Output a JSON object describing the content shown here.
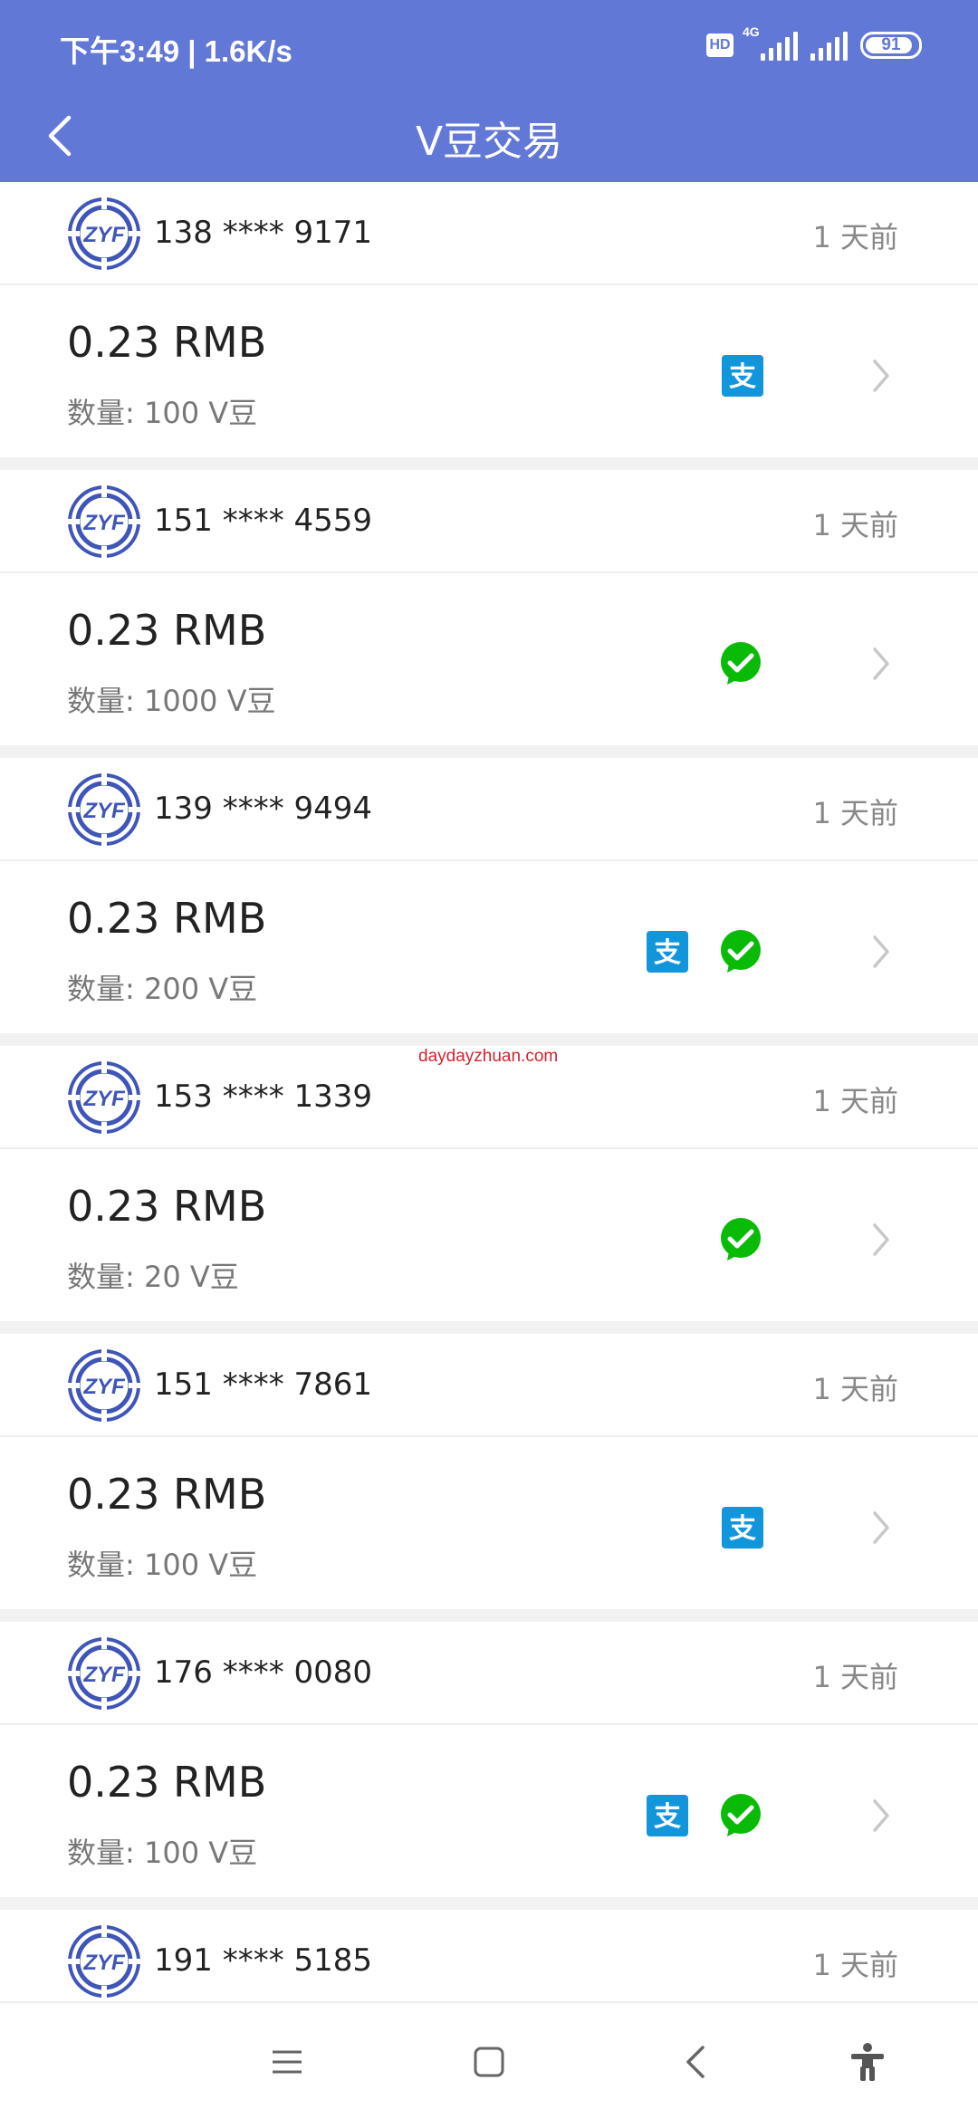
{
  "status_bar": {
    "text": "下午3:49 | 1.6K/s",
    "hd_label": "HD",
    "network_label": "4G",
    "battery": "91",
    "battery_level": 0.91
  },
  "header": {
    "title": "V豆交易",
    "back_icon": "chevron-left-icon"
  },
  "colors": {
    "header_bg": "#6178d6",
    "alipay": "#1296db",
    "wechat": "#09bb07",
    "logo": "#3f55b8",
    "watermark": "#d4232f"
  },
  "qty_prefix": "数量:",
  "transactions": [
    {
      "phone": "138 **** 9171",
      "time": "1 天前",
      "amount": "0.23 RMB",
      "qty": "100 V豆",
      "alipay": true,
      "wechat": false
    },
    {
      "phone": "151 **** 4559",
      "time": "1 天前",
      "amount": "0.23 RMB",
      "qty": "1000 V豆",
      "alipay": false,
      "wechat": true
    },
    {
      "phone": "139 **** 9494",
      "time": "1 天前",
      "amount": "0.23 RMB",
      "qty": "200 V豆",
      "alipay": true,
      "wechat": true
    },
    {
      "phone": "153 **** 1339",
      "time": "1 天前",
      "amount": "0.23 RMB",
      "qty": "20 V豆",
      "alipay": false,
      "wechat": true
    },
    {
      "phone": "151 **** 7861",
      "time": "1 天前",
      "amount": "0.23 RMB",
      "qty": "100 V豆",
      "alipay": true,
      "wechat": false
    },
    {
      "phone": "176 **** 0080",
      "time": "1 天前",
      "amount": "0.23 RMB",
      "qty": "100 V豆",
      "alipay": true,
      "wechat": true
    },
    {
      "phone": "191 **** 5185",
      "time": "1 天前",
      "amount": "",
      "qty": "",
      "alipay": false,
      "wechat": false
    }
  ],
  "watermark": "daydayzhuan.com",
  "logo_text": "ZYF",
  "alipay_glyph": "支",
  "nav": {
    "icons": [
      "menu-icon",
      "home-square-icon",
      "back-triangle-icon",
      "accessibility-icon"
    ]
  }
}
